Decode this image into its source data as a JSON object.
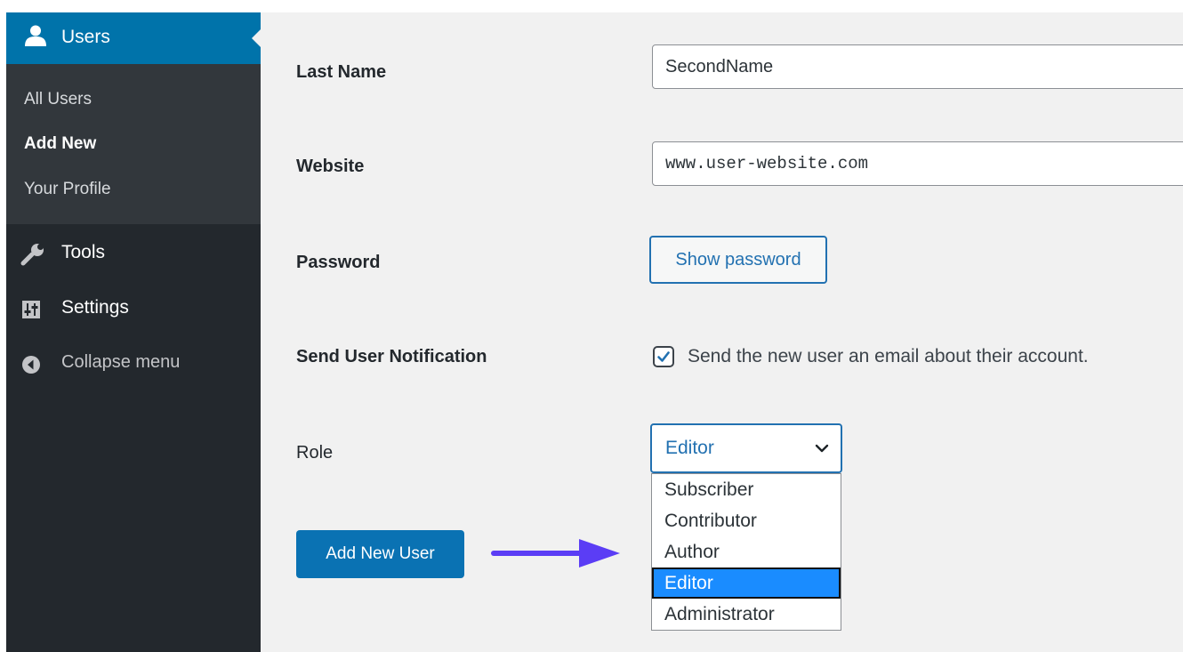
{
  "sidebar": {
    "users_label": "Users",
    "submenu": [
      "All Users",
      "Add New",
      "Your Profile"
    ],
    "tools_label": "Tools",
    "settings_label": "Settings",
    "collapse_label": "Collapse menu"
  },
  "form": {
    "last_name_label": "Last Name",
    "last_name_value": "SecondName",
    "website_label": "Website",
    "website_value": "www.user-website.com",
    "password_label": "Password",
    "show_password_label": "Show password",
    "notification_label": "Send User Notification",
    "notification_text": "Send the new user an email about their account.",
    "notification_checked": true,
    "role_label": "Role",
    "role_value": "Editor",
    "role_options": [
      "Subscriber",
      "Contributor",
      "Author",
      "Editor",
      "Administrator"
    ],
    "submit_label": "Add New User"
  },
  "colors": {
    "sidebar_bg": "#23282d",
    "submenu_bg": "#32373c",
    "accent": "#0073aa",
    "highlight": "#1a8cff",
    "annotation_arrow": "#5b3df5"
  },
  "icons": [
    "user-icon",
    "wrench-icon",
    "settings-icon",
    "collapse-icon",
    "check-icon",
    "chevron-down-icon",
    "annotation-arrow-icon"
  ]
}
